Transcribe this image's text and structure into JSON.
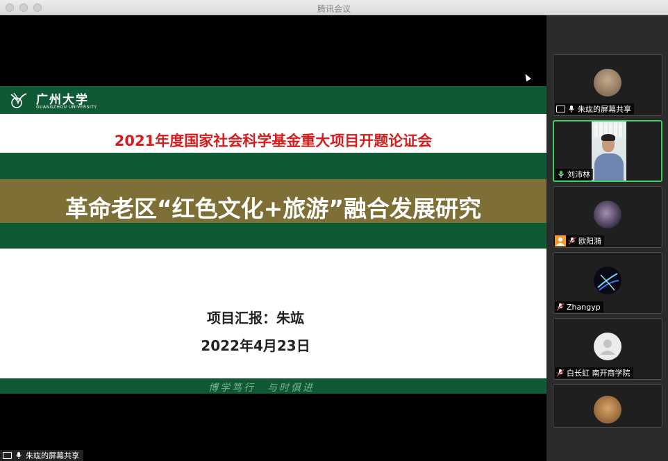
{
  "window": {
    "title": "腾讯会议"
  },
  "slide": {
    "logo_cn": "广州大学",
    "logo_en": "GUANGZHOU UNIVERSITY",
    "subtitle": "2021年度国家社会科学基金重大项目开题论证会",
    "main_title": "革命老区“红色文化+旅游”融合发展研究",
    "presenter": "项目汇报：朱竑",
    "date": "2022年4月23日",
    "motto": "博学笃行　与时俱进"
  },
  "stage_label": "朱竑的屏幕共享",
  "participants": [
    {
      "name": "朱竑的屏幕共享",
      "mic": "on",
      "screen_share": true,
      "avatar": "landscape-avatar"
    },
    {
      "name": "刘沛林",
      "mic": "active",
      "video": true
    },
    {
      "name": "欧阳漪",
      "mic": "muted",
      "badge": "person-icon",
      "avatar": "blurred-avatar"
    },
    {
      "name": "Zhangyp",
      "mic": "muted",
      "avatar": "abstract-avatar"
    },
    {
      "name": "白长虹 南开商学院",
      "mic": "muted",
      "avatar": "default-user-avatar"
    },
    {
      "name": "",
      "mic": "",
      "avatar": "mask-avatar"
    }
  ],
  "colors": {
    "slide_green": "#0f5a34",
    "slide_olive": "#7d6f35",
    "subtitle_red": "#d51d1d",
    "active_speaker": "#3ccf5c",
    "sidebar_bg": "#2b2b2b"
  }
}
